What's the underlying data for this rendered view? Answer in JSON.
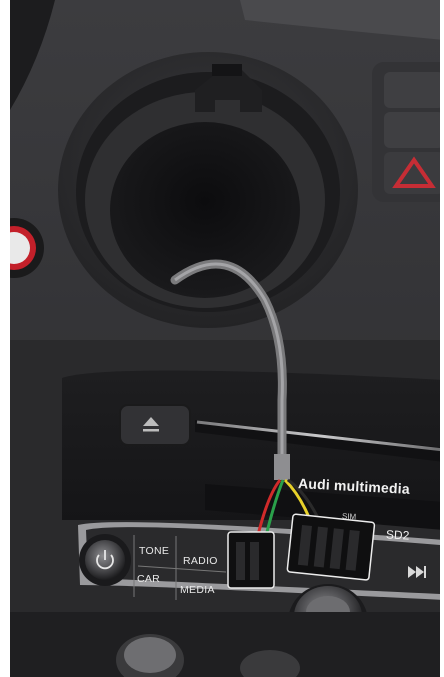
{
  "radio_unit": {
    "brand": "Audi multimedia",
    "slots": {
      "sim": "SIM",
      "sd2": "SD2"
    },
    "buttons": {
      "tone": "TONE",
      "radio": "RADIO",
      "car": "CAR",
      "media": "MEDIA"
    },
    "icons": [
      "power-icon",
      "eject-icon",
      "skip-forward-icon",
      "hazard-icon"
    ]
  }
}
